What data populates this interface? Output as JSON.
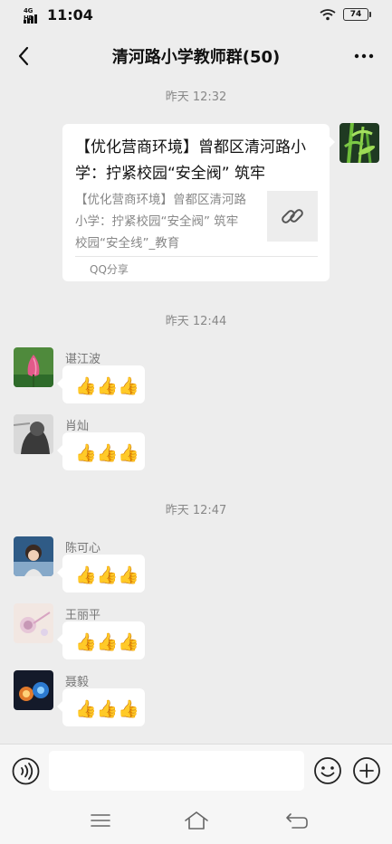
{
  "status_bar": {
    "network": "4G HD",
    "time": "11:04",
    "battery": "74"
  },
  "header": {
    "title": "清河路小学教师群(50)"
  },
  "messages": [
    {
      "type": "timestamp",
      "text": "昨天 12:32"
    },
    {
      "type": "share_card",
      "side": "right",
      "title": "【优化营商环境】曾都区清河路小学：拧紧校园“安全阀” 筑牢",
      "description": "【优化营商环境】曾都区清河路小学：拧紧校园“安全阀” 筑牢校园“安全线”_教育",
      "source": "QQ分享"
    },
    {
      "type": "timestamp",
      "text": "昨天 12:44"
    },
    {
      "type": "text",
      "side": "left",
      "sender": "谌江波",
      "content": "👍👍👍"
    },
    {
      "type": "text",
      "side": "left",
      "sender": "肖灿",
      "content": "👍👍👍"
    },
    {
      "type": "timestamp",
      "text": "昨天 12:47"
    },
    {
      "type": "text",
      "side": "left",
      "sender": "陈可心",
      "content": "👍👍👍"
    },
    {
      "type": "text",
      "side": "left",
      "sender": "王丽平",
      "content": "👍👍👍"
    },
    {
      "type": "text",
      "side": "left",
      "sender": "聂毅",
      "content": "👍👍👍"
    }
  ],
  "input_bar": {
    "value": "",
    "placeholder": ""
  },
  "icons": {
    "back": "back-arrow-icon",
    "more": "more-dots-icon",
    "voice": "voice-icon",
    "emoji": "emoji-icon",
    "plus": "plus-icon",
    "link": "link-icon",
    "menu": "menu-icon",
    "home": "home-icon",
    "return": "return-icon"
  }
}
